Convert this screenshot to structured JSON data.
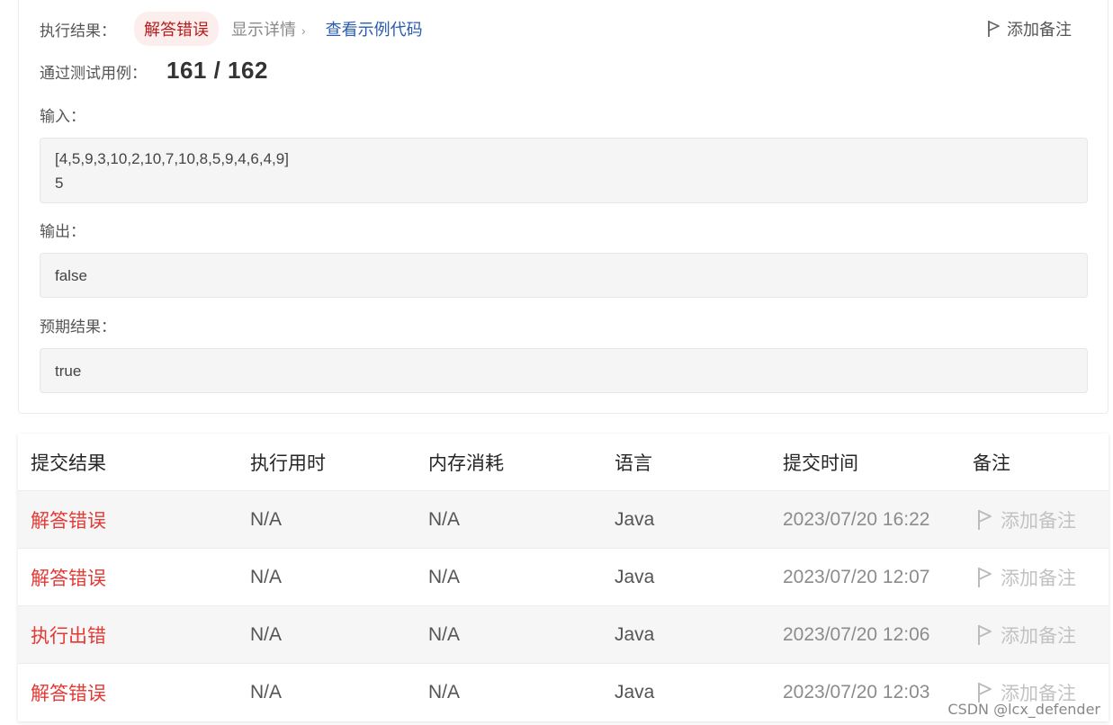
{
  "result": {
    "exec_label": "执行结果：",
    "status": "解答错误",
    "details_link": "显示详情",
    "chevron": "›",
    "sample_code_link": "查看示例代码",
    "add_note": "添加备注",
    "passed_label": "通过测试用例：",
    "passed_value": "161 / 162",
    "input_label": "输入：",
    "input_lines": [
      "[4,5,9,3,10,2,10,7,10,8,5,9,4,6,4,9]",
      "5"
    ],
    "output_label": "输出：",
    "output_value": "false",
    "expected_label": "预期结果：",
    "expected_value": "true"
  },
  "table": {
    "headers": [
      "提交结果",
      "执行用时",
      "内存消耗",
      "语言",
      "提交时间",
      "备注"
    ],
    "rows": [
      {
        "status": "解答错误",
        "runtime": "N/A",
        "memory": "N/A",
        "language": "Java",
        "time": "2023/07/20 16:22",
        "note": "添加备注"
      },
      {
        "status": "解答错误",
        "runtime": "N/A",
        "memory": "N/A",
        "language": "Java",
        "time": "2023/07/20 12:07",
        "note": "添加备注"
      },
      {
        "status": "执行出错",
        "runtime": "N/A",
        "memory": "N/A",
        "language": "Java",
        "time": "2023/07/20 12:06",
        "note": "添加备注"
      },
      {
        "status": "解答错误",
        "runtime": "N/A",
        "memory": "N/A",
        "language": "Java",
        "time": "2023/07/20 12:03",
        "note": "添加备注"
      }
    ]
  },
  "watermark": "CSDN @lcx_defender",
  "colors": {
    "error_red": "#e53935",
    "link_blue": "#2a5db0",
    "pill_bg": "#fdeeee"
  },
  "icons": {
    "flag": "flag-icon",
    "chevron": "chevron-right-icon"
  }
}
